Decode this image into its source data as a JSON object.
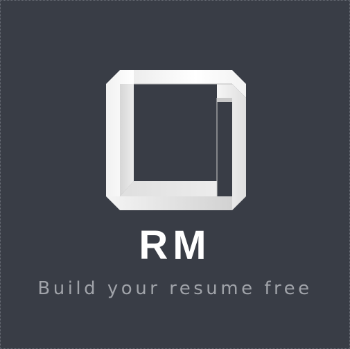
{
  "app": {
    "logo": {
      "icon": "impossible-square-icon",
      "text": "RM"
    },
    "tagline": "Build your resume free"
  },
  "colors": {
    "background": "#393d46",
    "logo_text": "#ffffff",
    "tagline": "#a0a3a9",
    "logo_light": "#ffffff",
    "logo_mid": "#e3e3e3",
    "logo_dark": "#c4c4c4"
  }
}
